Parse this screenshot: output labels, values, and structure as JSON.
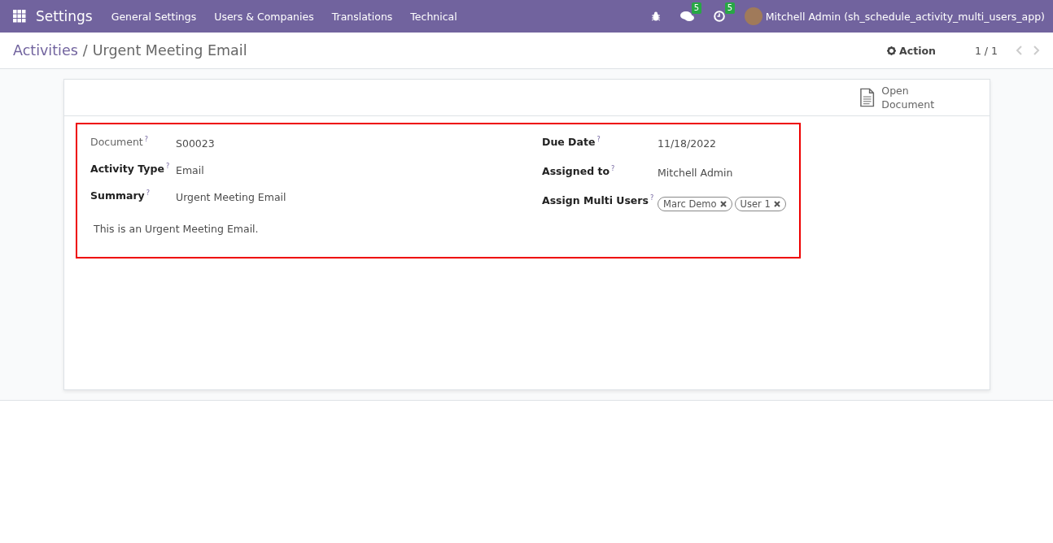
{
  "navbar": {
    "app_title": "Settings",
    "menu": [
      "General Settings",
      "Users & Companies",
      "Translations",
      "Technical"
    ],
    "messages_count": "5",
    "activities_count": "5",
    "user": "Mitchell Admin (sh_schedule_activity_multi_users_app)"
  },
  "breadcrumb": {
    "parent": "Activities",
    "separator": "/",
    "current": "Urgent Meeting Email"
  },
  "control_panel": {
    "action": "Action",
    "pager": "1 / 1"
  },
  "button_box": {
    "open_document": "Open Document"
  },
  "left_fields": [
    {
      "label": "Document",
      "help": "?",
      "value": "S00023",
      "readonly": true
    },
    {
      "label": "Activity Type",
      "help": "?",
      "value": "Email",
      "readonly": false
    },
    {
      "label": "Summary",
      "help": "?",
      "value": "Urgent Meeting Email",
      "readonly": false
    }
  ],
  "note": "This is an Urgent Meeting Email.",
  "right_fields": [
    {
      "label": "Due Date",
      "help": "?",
      "value": "11/18/2022"
    },
    {
      "label": "Assigned to",
      "help": "?",
      "value": "Mitchell Admin"
    },
    {
      "label": "Assign Multi Users",
      "help": "?",
      "tags": [
        "Marc Demo",
        "User 1"
      ]
    }
  ]
}
